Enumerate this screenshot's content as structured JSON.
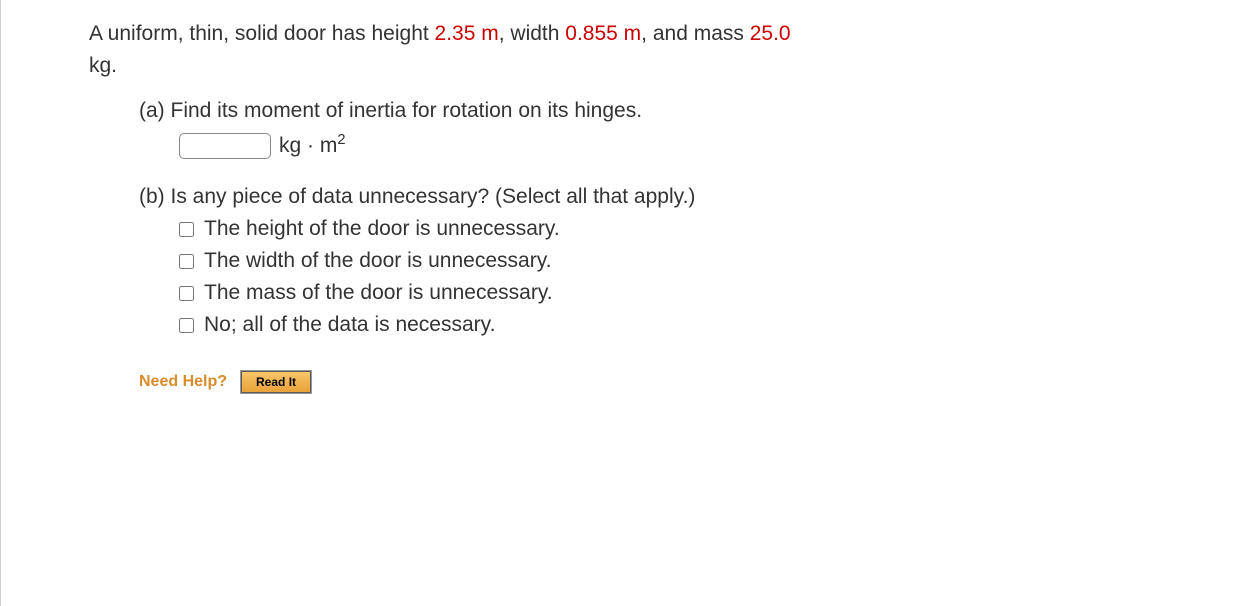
{
  "stem": {
    "t1": "A uniform, thin, solid door has height ",
    "v1": "2.35 m",
    "t2": ", width ",
    "v2": "0.855 m",
    "t3": ", and mass ",
    "v3": "25.0",
    "t4": "kg."
  },
  "partA": {
    "label": "(a) ",
    "text": "Find its moment of inertia for rotation on its hinges.",
    "unit_prefix": "kg · m",
    "unit_exp": "2",
    "input_value": ""
  },
  "partB": {
    "label": "(b) ",
    "text": "Is any piece of data unnecessary? (Select all that apply.)",
    "options": [
      "The height of the door is unnecessary.",
      "The width of the door is unnecessary.",
      "The mass of the door is unnecessary.",
      "No; all of the data is necessary."
    ]
  },
  "help": {
    "label": "Need Help?",
    "read": "Read It"
  }
}
